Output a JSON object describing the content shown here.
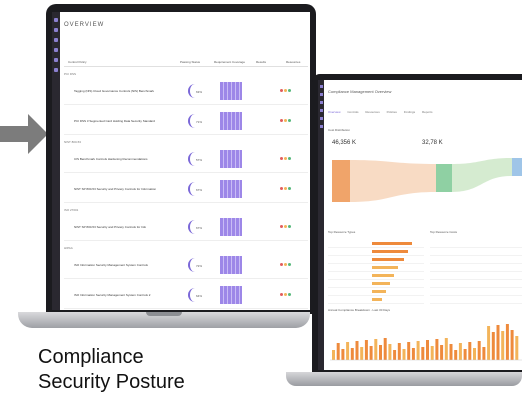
{
  "caption": {
    "line1": "Compliance",
    "line2": "Security Posture"
  },
  "colors": {
    "arrow": "#7c7c7c",
    "accent": "#7b68d8",
    "bar_orange": "#ee8a3c",
    "bar_yellow": "#f3b45a"
  },
  "left_screen": {
    "title": "OVERVIEW",
    "columns": [
      "Control Policy",
      "Passing Status",
      "Requirement Coverage",
      "Results",
      "Resources"
    ],
    "groups": [
      "PCI DSS",
      "NIST 800-53",
      "ISO 27001",
      "HIPAA"
    ],
    "rows": [
      {
        "name": "Tagging (NIS) Cloud Governance Controls (NIS) Benchmark",
        "pct": "63%"
      },
      {
        "name": "PCI DSS 3 Segmented Card Holding Data Security Standard",
        "pct": "71%"
      },
      {
        "name": "CIS Benchmark Controls Hardening Recommendations",
        "pct": "57%"
      },
      {
        "name": "NIST SP 800-53 Security and Privacy Controls for Information",
        "pct": "67%"
      },
      {
        "name": "NIST SP 800-53 Security and Privacy Controls for Info",
        "pct": "67%"
      },
      {
        "name": "ISO Information Security Management System Controls",
        "pct": "72%"
      },
      {
        "name": "ISO Information Security Management System Controls 2",
        "pct": "64%"
      }
    ]
  },
  "right_screen": {
    "title": "Compliance Management Overview",
    "tabs": [
      "Overview",
      "Controls",
      "Resources",
      "Policies",
      "Findings",
      "Reports"
    ],
    "section": "Cost Distribution",
    "kpi1": "46,356 K",
    "kpi2": "32,78 K",
    "table1_title": "Top Resource Types",
    "table2_title": "Top Resource Costs",
    "chart_title": "Annual Compliance Breakdown - Last 30 Days"
  }
}
